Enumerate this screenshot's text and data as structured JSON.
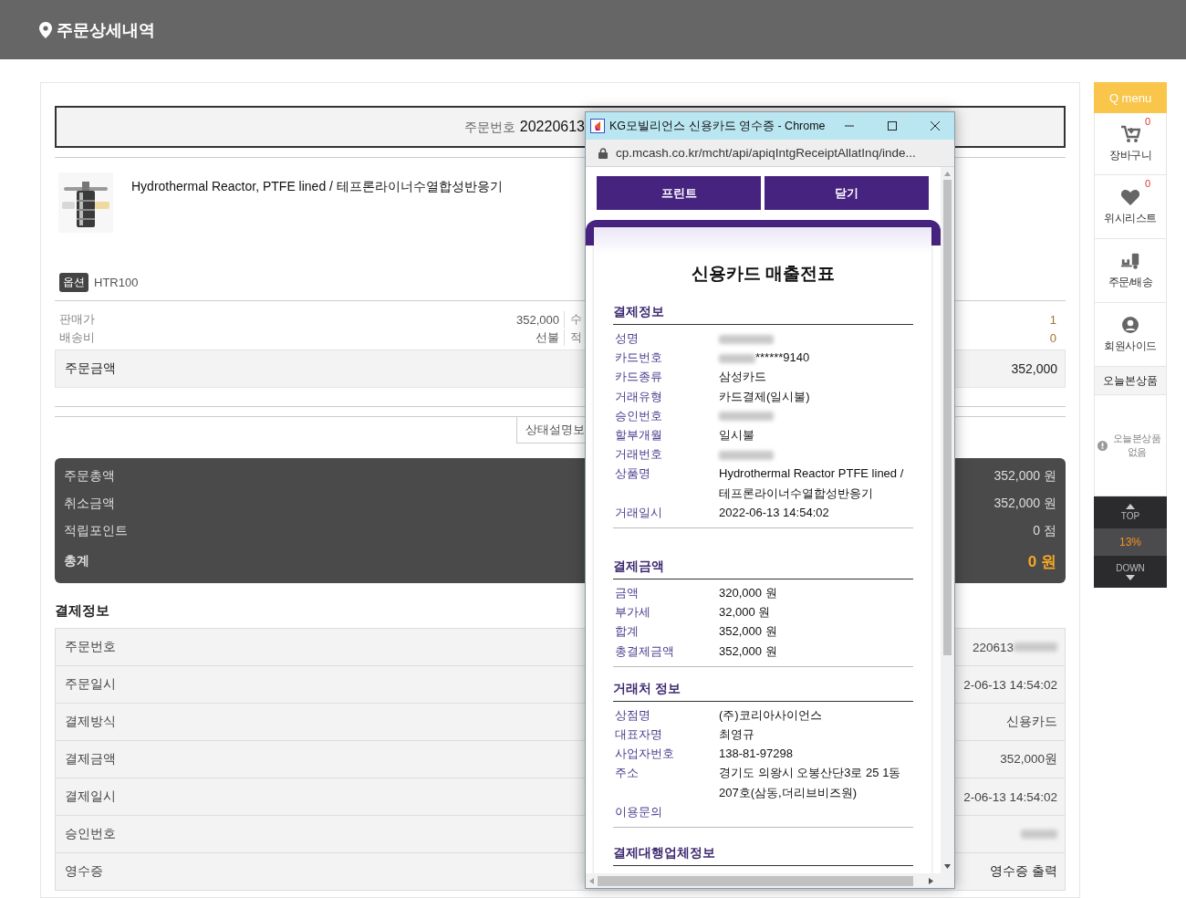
{
  "header": {
    "title": "주문상세내역"
  },
  "order_box": {
    "label": "주문번호",
    "value": "20220613"
  },
  "product": {
    "name": "Hydrothermal Reactor, PTFE lined / 테프론라이너수열합성반응기",
    "option_label": "옵션",
    "option_value": "HTR100"
  },
  "price_rows": [
    {
      "label": "판매가",
      "value": "352,000",
      "label_2": "수",
      "value_2": "1"
    },
    {
      "label": "배송비",
      "value": "선불",
      "label_2": "적",
      "value_2": "0"
    }
  ],
  "order_amount": {
    "label": "주문금액",
    "value": "352,000"
  },
  "status_tab": {
    "label": "상태설명보"
  },
  "summary": [
    {
      "label": "주문총액",
      "value": "352,000 원",
      "kind": "normal"
    },
    {
      "label": "취소금액",
      "value": "352,000 원",
      "kind": "normal"
    },
    {
      "label": "적립포인트",
      "value": "0 점",
      "kind": "normal"
    },
    {
      "label": "총계",
      "value": "0 원",
      "kind": "total"
    }
  ],
  "payment_info": {
    "title": "결제정보",
    "rows": [
      {
        "label": "주문번호",
        "value": "220613",
        "redacted": true,
        "kind": "text"
      },
      {
        "label": "주문일시",
        "value": "2-06-13 14:54:02",
        "redacted": false,
        "kind": "text"
      },
      {
        "label": "결제방식",
        "value": "신용카드",
        "redacted": false,
        "kind": "text"
      },
      {
        "label": "결제금액",
        "value": "352,000원",
        "redacted": false,
        "kind": "text"
      },
      {
        "label": "결제일시",
        "value": "2-06-13 14:54:02",
        "redacted": false,
        "kind": "text"
      },
      {
        "label": "승인번호",
        "redacted": true,
        "kind": "text"
      },
      {
        "label": "영수증",
        "value": "영수증 출력",
        "redacted": false,
        "kind": "link"
      }
    ]
  },
  "q_menu": {
    "title": "Q menu",
    "items": [
      {
        "label": "장바구니",
        "count": "0"
      },
      {
        "label": "위시리스트",
        "count": "0"
      },
      {
        "label": "주문/배송"
      },
      {
        "label": "회원사이드"
      }
    ],
    "recent": {
      "title": "오늘본상품",
      "empty_text": "오늘본상품 없음"
    },
    "nav": {
      "top": "TOP",
      "percent": "13%",
      "down": "DOWN"
    }
  },
  "popup": {
    "title": "KG모빌리언스 신용카드 영수증 - Chrome",
    "url": "cp.mcash.co.kr/mcht/api/apiqIntgReceiptAllatInq/inde...",
    "buttons": [
      "프린트",
      "닫기"
    ],
    "receipt_title": "신용카드 매출전표",
    "sections": [
      {
        "title": "결제정보",
        "rows": [
          {
            "label": "성명",
            "redacted": true
          },
          {
            "label": "카드번호",
            "value": "******9140",
            "redacted": true
          },
          {
            "label": "카드종류",
            "value": "삼성카드",
            "redacted": false
          },
          {
            "label": "거래유형",
            "value": "카드결제(일시불)",
            "redacted": false
          },
          {
            "label": "승인번호",
            "redacted": true
          },
          {
            "label": "할부개월",
            "value": "일시불",
            "redacted": false
          },
          {
            "label": "거래번호",
            "redacted": true
          },
          {
            "label": "상품명",
            "value": "Hydrothermal Reactor PTFE lined / 테프론라이너수열합성반응기",
            "redacted": false
          },
          {
            "label": "거래일시",
            "value": "2022-06-13 14:54:02",
            "redacted": false
          }
        ]
      },
      {
        "title": "결제금액",
        "rows": [
          {
            "label": "금액",
            "value": "320,000 원",
            "redacted": false
          },
          {
            "label": "부가세",
            "value": "32,000 원",
            "redacted": false
          },
          {
            "label": "합계",
            "value": "352,000 원",
            "redacted": false
          },
          {
            "label": "총결제금액",
            "value": "352,000 원",
            "redacted": false
          }
        ]
      },
      {
        "title": "거래처 정보",
        "rows": [
          {
            "label": "상점명",
            "value": "(주)코리아사이언스",
            "redacted": false
          },
          {
            "label": "대표자명",
            "value": "최영규",
            "redacted": false
          },
          {
            "label": "사업자번호",
            "value": "138-81-97298",
            "redacted": false
          },
          {
            "label": "주소",
            "value": "경기도 의왕시 오봉산단3로 25 1동 207호(삼동,더리브비즈원)",
            "redacted": false
          },
          {
            "label": "이용문의",
            "redacted": false
          }
        ]
      },
      {
        "title": "결제대행업체정보"
      }
    ]
  }
}
